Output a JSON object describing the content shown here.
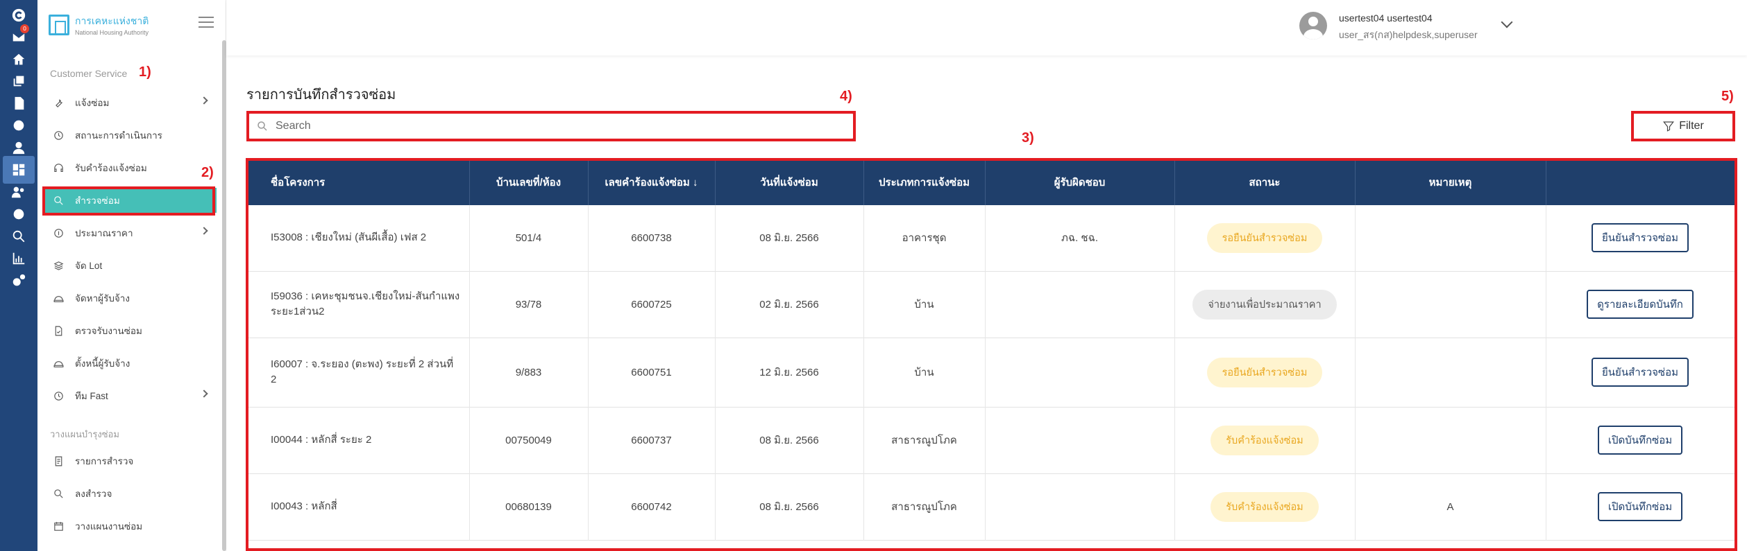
{
  "rail": {
    "inbox_badge": "0",
    "icons": [
      "logo-icon",
      "inbox-icon",
      "home-icon",
      "copy-icon",
      "document-icon",
      "settings-icon",
      "user-icon",
      "dashboard-icon",
      "team-icon",
      "gear-icon",
      "search-icon",
      "chart-icon",
      "cogs-icon"
    ]
  },
  "sidebar": {
    "logo_th": "การเคหะแห่งชาติ",
    "logo_en": "National Housing Authority",
    "section1": "Customer Service",
    "items1": [
      {
        "label": "แจ้งซ่อม",
        "icon": "wrench-icon",
        "chevron": true
      },
      {
        "label": "สถานะการดำเนินการ",
        "icon": "history-icon",
        "chevron": false
      },
      {
        "label": "รับคำร้องแจ้งซ่อม",
        "icon": "headset-icon",
        "chevron": false
      },
      {
        "label": "สำรวจซ่อม",
        "icon": "search-icon",
        "chevron": false,
        "active": true
      },
      {
        "label": "ประมาณราคา",
        "icon": "coin-icon",
        "chevron": true
      },
      {
        "label": "จัด Lot",
        "icon": "layers-icon",
        "chevron": false
      },
      {
        "label": "จัดหาผู้รับจ้าง",
        "icon": "helmet-icon",
        "chevron": false
      },
      {
        "label": "ตรวจรับงานซ่อม",
        "icon": "file-check-icon",
        "chevron": false
      },
      {
        "label": "ตั้งหนี้ผู้รับจ้าง",
        "icon": "helmet-icon",
        "chevron": false
      },
      {
        "label": "ทีม Fast",
        "icon": "history-icon",
        "chevron": true
      }
    ],
    "section2": "วางแผนบำรุงซ่อม",
    "items2": [
      {
        "label": "รายการสำรวจ",
        "icon": "list-icon"
      },
      {
        "label": "ลงสำรวจ",
        "icon": "search-icon"
      },
      {
        "label": "วางแผนงานซ่อม",
        "icon": "calendar-icon"
      }
    ]
  },
  "header": {
    "user_name": "usertest04 usertest04",
    "user_role": "user_สร(กส)helpdesk,superuser"
  },
  "main": {
    "title": "รายการบันทึกสำรวจซ่อม",
    "search_placeholder": "Search",
    "filter_label": "Filter",
    "columns": [
      "ชื่อโครงการ",
      "บ้านเลขที่/ห้อง",
      "เลขคำร้องแจ้งซ่อม ↓",
      "วันที่แจ้งซ่อม",
      "ประเภทการแจ้งซ่อม",
      "ผู้รับผิดชอบ",
      "สถานะ",
      "หมายเหตุ",
      ""
    ],
    "rows": [
      {
        "project": "I53008 : เชียงใหม่ (สันผีเสื้อ) เฟส 2",
        "house": "501/4",
        "req": "6600738",
        "date": "08 มิ.ย. 2566",
        "type": "อาคารชุด",
        "owner": "ภฉ. ชฉ.",
        "status": "รอยืนยันสำรวจซ่อม",
        "status_color": "yellow",
        "note": "",
        "action": "ยืนยันสำรวจซ่อม"
      },
      {
        "project": "I59036 : เคหะชุมชนจ.เชียงใหม่-สันกำแพงระยะ1ส่วน2",
        "house": "93/78",
        "req": "6600725",
        "date": "02 มิ.ย. 2566",
        "type": "บ้าน",
        "owner": "",
        "status": "จ่ายงานเพื่อประมาณราคา",
        "status_color": "gray",
        "note": "",
        "action": "ดูรายละเอียดบันทึก"
      },
      {
        "project": "I60007 : จ.ระยอง (ตะพง) ระยะที่ 2 ส่วนที่ 2",
        "house": "9/883",
        "req": "6600751",
        "date": "12 มิ.ย. 2566",
        "type": "บ้าน",
        "owner": "",
        "status": "รอยืนยันสำรวจซ่อม",
        "status_color": "yellow",
        "note": "",
        "action": "ยืนยันสำรวจซ่อม"
      },
      {
        "project": "I00044 : หลักสี่ ระยะ 2",
        "house": "00750049",
        "req": "6600737",
        "date": "08 มิ.ย. 2566",
        "type": "สาธารณูปโภค",
        "owner": "",
        "status": "รับคำร้องแจ้งซ่อม",
        "status_color": "yellow",
        "note": "",
        "action": "เปิดบันทึกซ่อม"
      },
      {
        "project": "I00043 : หลักสี่",
        "house": "00680139",
        "req": "6600742",
        "date": "08 มิ.ย. 2566",
        "type": "สาธารณูปโภค",
        "owner": "",
        "status": "รับคำร้องแจ้งซ่อม",
        "status_color": "yellow",
        "note": "A",
        "action": "เปิดบันทึกซ่อม"
      }
    ]
  },
  "annotations": [
    "1)",
    "2)",
    "3)",
    "4)",
    "5)"
  ],
  "colors": {
    "rail": "#21467a",
    "header_row": "#1f3f6b",
    "active_item": "#45bfb7",
    "annotation": "#e31c22"
  }
}
